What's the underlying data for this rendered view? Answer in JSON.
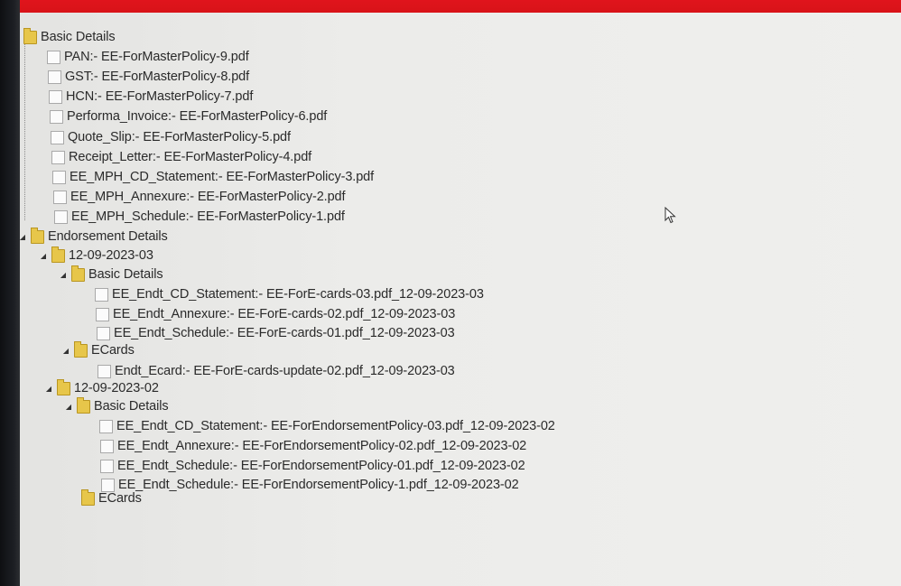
{
  "header": {
    "accent_color": "#e0141c"
  },
  "tree": {
    "basic_details": {
      "label": "Basic Details",
      "files": [
        "PAN:- EE-ForMasterPolicy-9.pdf",
        "GST:- EE-ForMasterPolicy-8.pdf",
        "HCN:- EE-ForMasterPolicy-7.pdf",
        "Performa_Invoice:- EE-ForMasterPolicy-6.pdf",
        "Quote_Slip:- EE-ForMasterPolicy-5.pdf",
        "Receipt_Letter:- EE-ForMasterPolicy-4.pdf",
        "EE_MPH_CD_Statement:- EE-ForMasterPolicy-3.pdf",
        "EE_MPH_Annexure:- EE-ForMasterPolicy-2.pdf",
        "EE_MPH_Schedule:- EE-ForMasterPolicy-1.pdf"
      ]
    },
    "endorsement_details": {
      "label": "Endorsement Details",
      "groups": [
        {
          "label": "12-09-2023-03",
          "basic_details_label": "Basic Details",
          "basic_files": [
            "EE_Endt_CD_Statement:- EE-ForE-cards-03.pdf_12-09-2023-03",
            "EE_Endt_Annexure:- EE-ForE-cards-02.pdf_12-09-2023-03",
            "EE_Endt_Schedule:- EE-ForE-cards-01.pdf_12-09-2023-03"
          ],
          "ecards_label": "ECards",
          "ecards_files": [
            "Endt_Ecard:- EE-ForE-cards-update-02.pdf_12-09-2023-03"
          ]
        },
        {
          "label": "12-09-2023-02",
          "basic_details_label": "Basic Details",
          "basic_files": [
            "EE_Endt_CD_Statement:- EE-ForEndorsementPolicy-03.pdf_12-09-2023-02",
            "EE_Endt_Annexure:- EE-ForEndorsementPolicy-02.pdf_12-09-2023-02",
            "EE_Endt_Schedule:- EE-ForEndorsementPolicy-01.pdf_12-09-2023-02",
            "EE_Endt_Schedule:- EE-ForEndorsementPolicy-1.pdf_12-09-2023-02"
          ],
          "ecards_label": "ECards"
        }
      ]
    }
  },
  "icons": {
    "folder": "folder-icon",
    "file": "file-icon",
    "toggle": "expanded-toggle-icon",
    "cursor": "mouse-cursor-icon"
  }
}
